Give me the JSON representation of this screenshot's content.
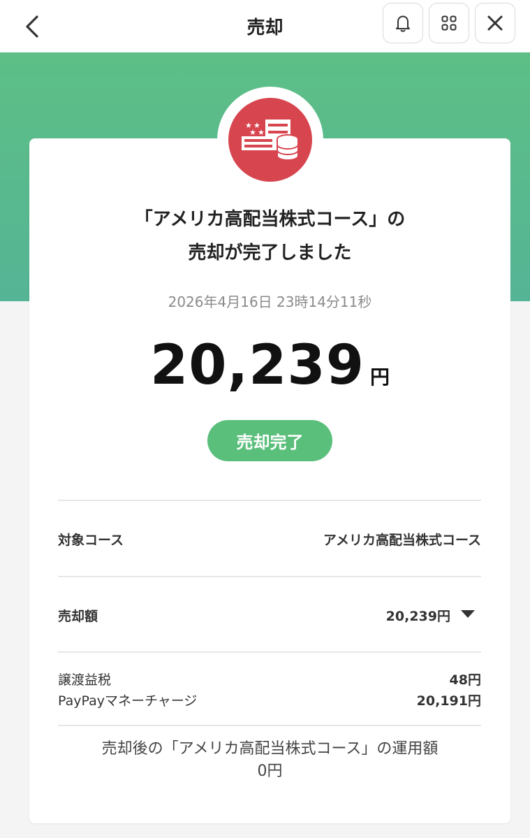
{
  "header": {
    "title": "売却"
  },
  "colors": {
    "hero": "#5dbf86",
    "accent": "#5bbf7c",
    "logo": "#d7454f"
  },
  "result": {
    "message_line1": "「アメリカ高配当株式コース」の",
    "message_line2": "売却が完了しました",
    "datetime": "2026年4月16日 23時14分11秒",
    "amount": "20,239",
    "amount_unit": "円",
    "status": "売却完了"
  },
  "details": {
    "course_label": "対象コース",
    "course_value": "アメリカ高配当株式コース",
    "sale_label": "売却額",
    "sale_value": "20,239円",
    "tax_label": "譲渡益税",
    "tax_value": "48円",
    "charge_label": "PayPayマネーチャージ",
    "charge_value": "20,191円"
  },
  "footer": {
    "line1": "売却後の「アメリカ高配当株式コース」の運用額",
    "line2": "0円"
  }
}
